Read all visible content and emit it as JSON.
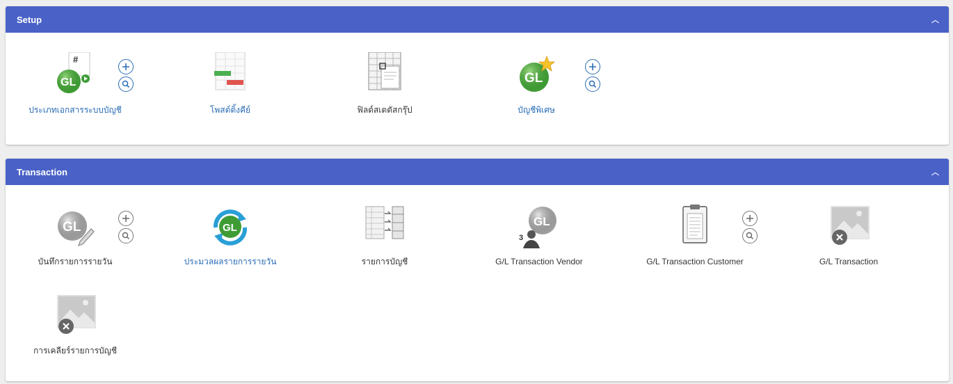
{
  "setup": {
    "title": "Setup",
    "items": [
      {
        "label": "ประเภทเอกสารระบบบัญชี",
        "icon": "gl-document-type-icon",
        "style": "link",
        "has_actions": true
      },
      {
        "label": "โพสต์ติ้งคีย์",
        "icon": "posting-key-icon",
        "style": "link",
        "has_actions": false
      },
      {
        "label": "ฟิลด์สเตตัสกรุ๊ป",
        "icon": "field-status-group-icon",
        "style": "plain",
        "has_actions": false
      },
      {
        "label": "บัญชีพิเศษ",
        "icon": "gl-star-icon",
        "style": "link",
        "has_actions": true
      }
    ]
  },
  "transaction": {
    "title": "Transaction",
    "items": [
      {
        "label": "บันทึกรายการรายวัน",
        "icon": "gl-pencil-icon",
        "style": "plain",
        "has_actions": true
      },
      {
        "label": "ประมวลผลรายการรายวัน",
        "icon": "gl-refresh-icon",
        "style": "link",
        "has_actions": false
      },
      {
        "label": "รายการบัญชี",
        "icon": "account-list-icon",
        "style": "plain",
        "has_actions": false
      },
      {
        "label": "G/L Transaction Vendor",
        "icon": "gl-vendor-icon",
        "style": "plain",
        "has_actions": false
      },
      {
        "label": "G/L Transaction Customer",
        "icon": "clipboard-icon",
        "style": "plain",
        "has_actions": true
      },
      {
        "label": "G/L Transaction",
        "icon": "broken-image-icon",
        "style": "plain",
        "has_actions": false
      },
      {
        "label": "การเคลียร์รายการบัญชี",
        "icon": "broken-image-icon",
        "style": "plain",
        "has_actions": false
      }
    ]
  },
  "colors": {
    "header": "#4a62c7",
    "link": "#2a6db5",
    "gl_green": "#4caf50"
  }
}
